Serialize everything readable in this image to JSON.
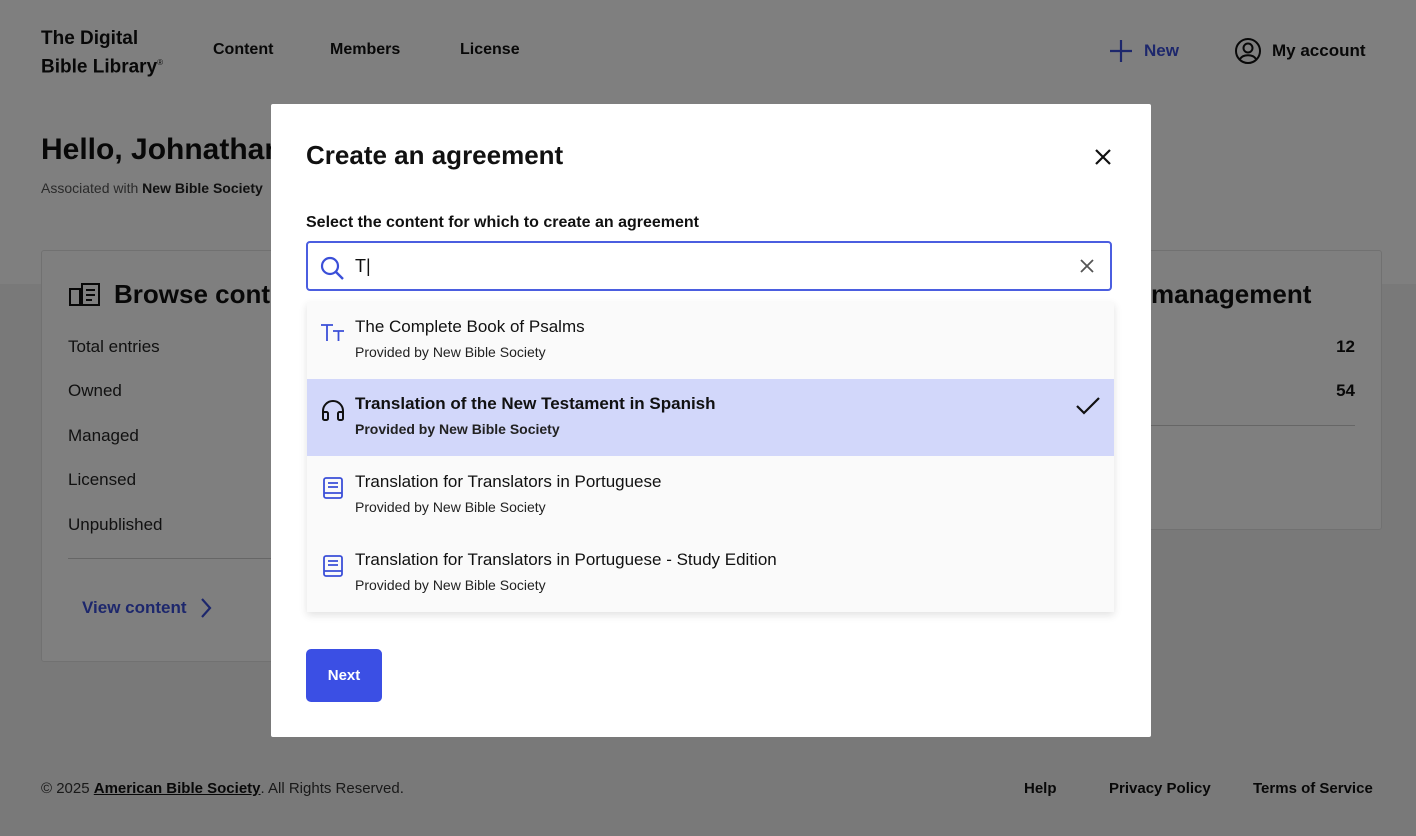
{
  "header": {
    "logo_line1": "The Digital",
    "logo_line2": "Bible Library",
    "logo_reg": "®",
    "nav": [
      "Content",
      "Members",
      "License"
    ],
    "new_label": "New",
    "account_label": "My account"
  },
  "greeting": {
    "hello": "Hello, Johnathan",
    "associated_prefix": "Associated with ",
    "organization": "New Bible Society"
  },
  "browse_card": {
    "title": "Browse content",
    "stats": [
      "Total entries",
      "Owned",
      "Managed",
      "Licensed",
      "Unpublished"
    ],
    "view_link": "View content"
  },
  "management_card": {
    "title": "management",
    "values": [
      "12",
      "54"
    ]
  },
  "footer": {
    "copyright_prefix": "© 2025 ",
    "copyright_org": "American Bible Society",
    "copyright_suffix": ". All Rights Reserved.",
    "links": [
      "Help",
      "Privacy Policy",
      "Terms of Service"
    ]
  },
  "modal": {
    "title": "Create an agreement",
    "select_label": "Select the content for which to create an agreement",
    "search_value": "T|",
    "options": [
      {
        "icon": "text-icon",
        "title": "The Complete Book of Psalms",
        "subtitle": "Provided by New Bible Society",
        "selected": false
      },
      {
        "icon": "headphones-icon",
        "title": "Translation of the New Testament in Spanish",
        "subtitle": "Provided by New Bible Society",
        "selected": true
      },
      {
        "icon": "book-icon",
        "title": "Translation for Translators in Portuguese",
        "subtitle": "Provided by New Bible Society",
        "selected": false
      },
      {
        "icon": "book-icon",
        "title": "Translation for Translators in Portuguese - Study Edition",
        "subtitle": "Provided by New Bible Society",
        "selected": false
      }
    ],
    "next_label": "Next"
  },
  "colors": {
    "accent": "#3b4fe4",
    "selected_bg": "#d2d7fa",
    "overlay": "rgba(0,0,0,0.5)"
  }
}
